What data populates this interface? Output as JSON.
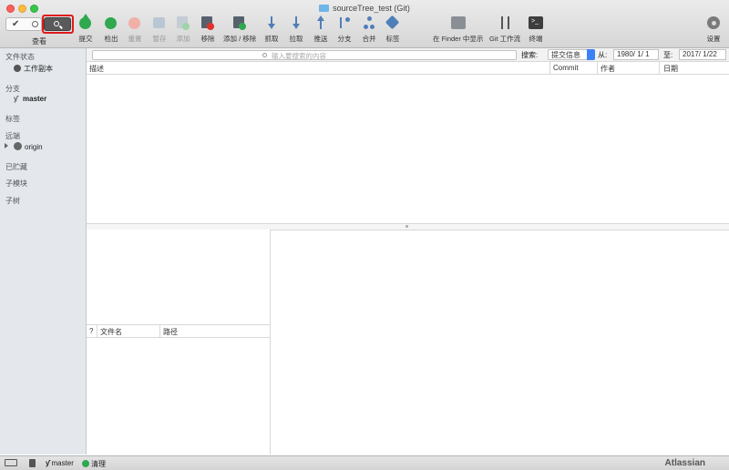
{
  "window": {
    "title": "sourceTree_test (Git)"
  },
  "toolbar": {
    "view_label": "查看",
    "commit": "提交",
    "checkout": "检出",
    "reset": "重置",
    "stash": "暂存",
    "add": "添加",
    "remove": "移除",
    "add_remove": "添加 / 移除",
    "fetch": "抓取",
    "pull": "拉取",
    "push": "推送",
    "branch": "分支",
    "merge": "合并",
    "tag": "标签",
    "finder": "在 Finder 中显示",
    "git_flow": "Git 工作流",
    "terminal": "终端",
    "settings": "设置"
  },
  "sidebar": {
    "file_status": "文件状态",
    "working_copy": "工作副本",
    "branches": "分支",
    "master": "master",
    "tags": "标签",
    "remotes": "远端",
    "origin": "origin",
    "stashes": "已贮藏",
    "submodules": "子模块",
    "subtrees": "子树"
  },
  "search": {
    "placeholder": "输入要搜索的内容",
    "label": "搜索:",
    "mode": "提交信息",
    "from_label": "从:",
    "from_date": "1980/  1/  1",
    "to_label": "至:",
    "to_date": "2017/  1/22"
  },
  "columns": {
    "description": "描述",
    "commit": "Commit",
    "author": "作者",
    "date": "日期"
  },
  "file_columns": {
    "status": "?",
    "filename": "文件名",
    "path": "路径"
  },
  "statusbar": {
    "branch": "master",
    "clean": "清理",
    "brand": "Atlassian"
  },
  "colors": {
    "highlight": "#e01b1b",
    "accent": "#3b82f6",
    "green": "#2fa84f"
  }
}
